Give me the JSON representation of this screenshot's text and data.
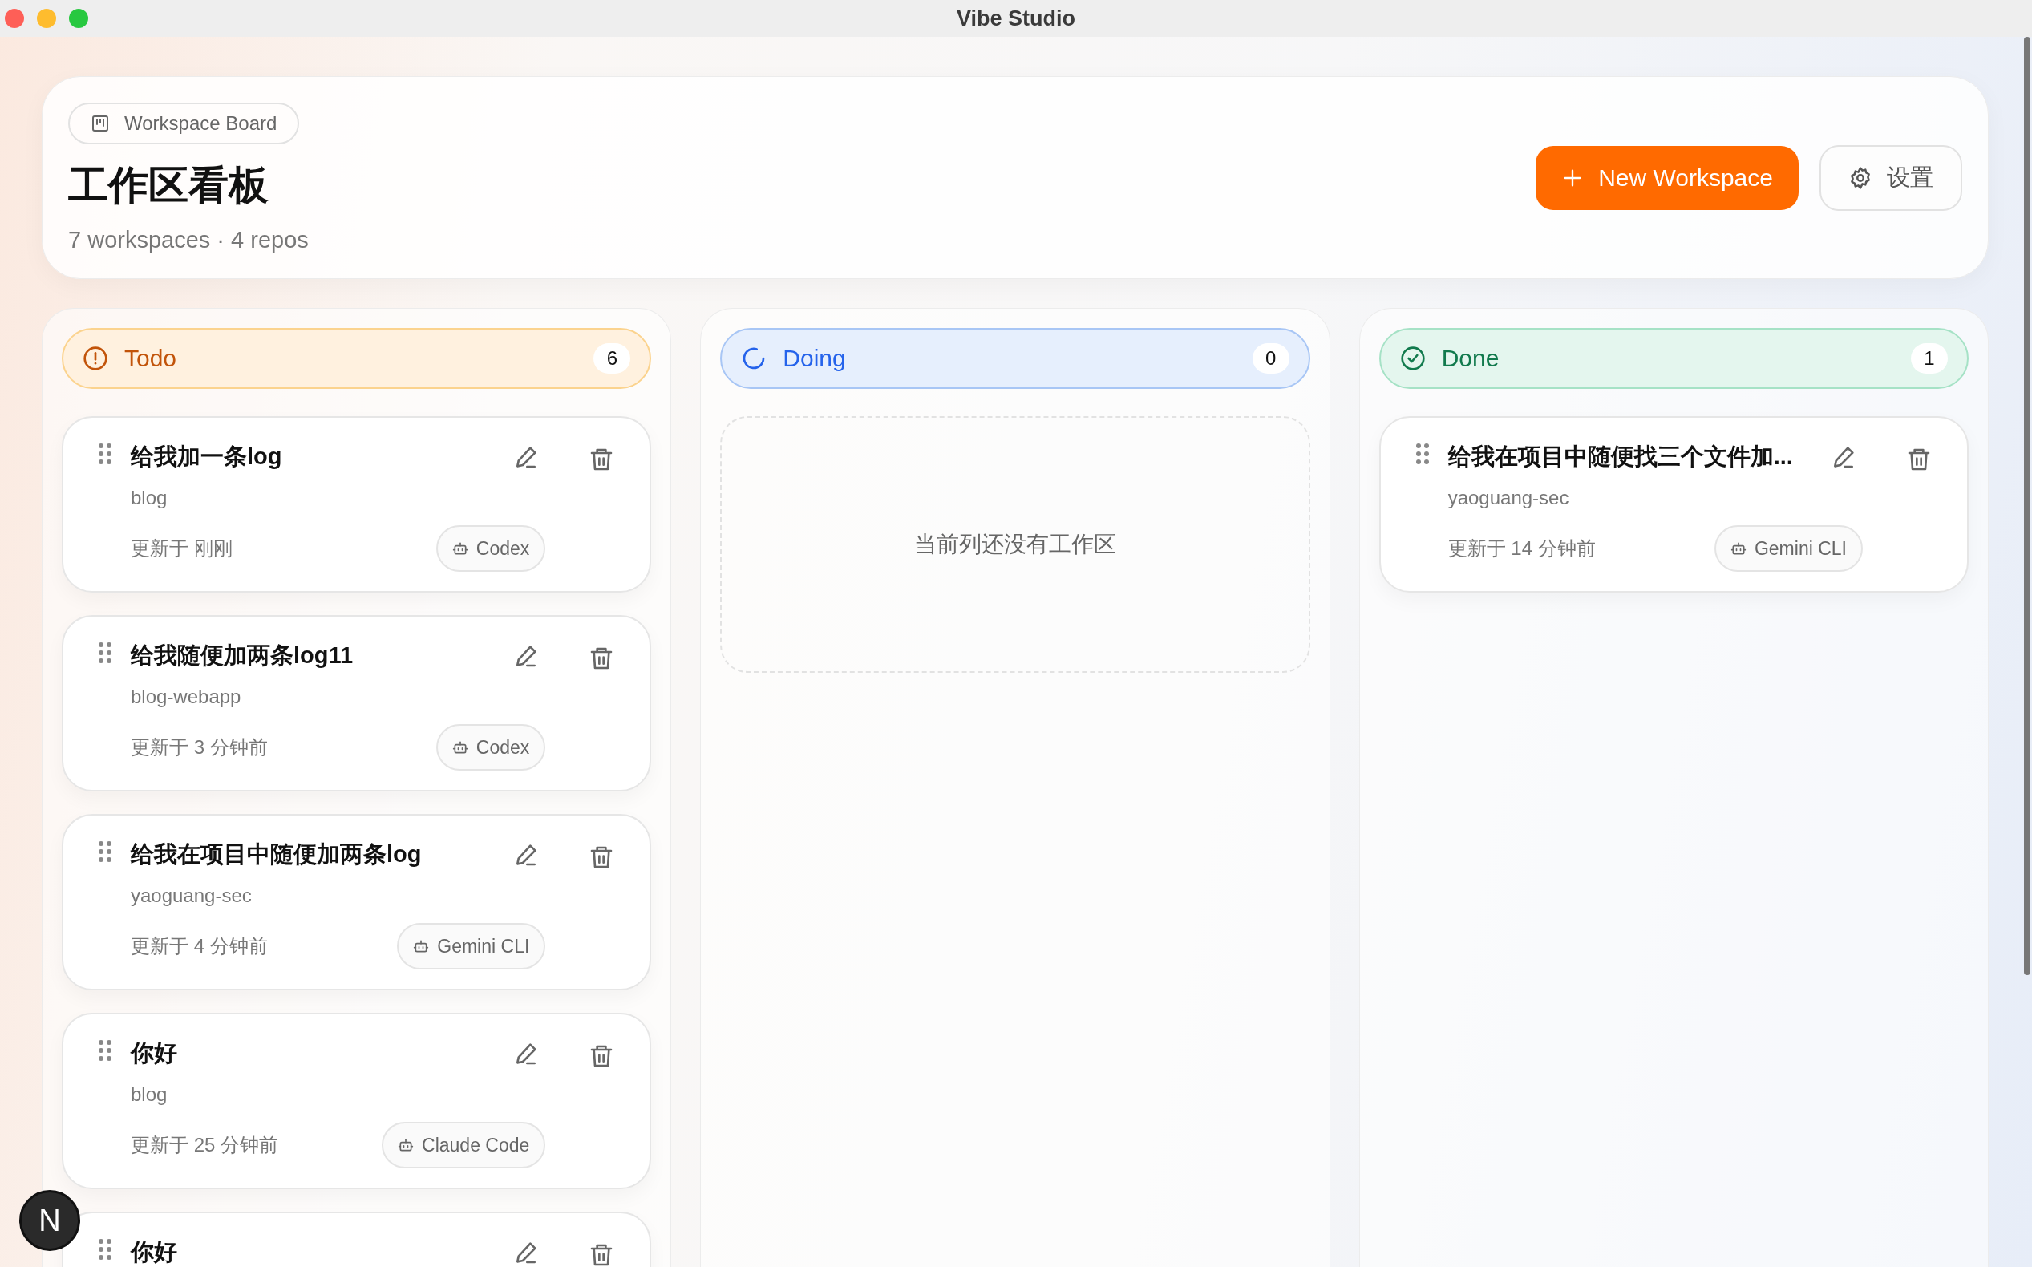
{
  "window": {
    "title": "Vibe Studio"
  },
  "header": {
    "badge": "Workspace Board",
    "title": "工作区看板",
    "subtitle": "7 workspaces · 4 repos",
    "new_button": "New Workspace",
    "settings_button": "设置"
  },
  "columns": [
    {
      "kind": "todo",
      "label": "Todo",
      "count": "6",
      "cards": [
        {
          "title": "给我加一条log",
          "repo": "blog",
          "updated": "更新于 刚刚",
          "agent": "Codex"
        },
        {
          "title": "给我随便加两条log11",
          "repo": "blog-webapp",
          "updated": "更新于 3 分钟前",
          "agent": "Codex"
        },
        {
          "title": "给我在项目中随便加两条log",
          "repo": "yaoguang-sec",
          "updated": "更新于 4 分钟前",
          "agent": "Gemini CLI"
        },
        {
          "title": "你好",
          "repo": "blog",
          "updated": "更新于 25 分钟前",
          "agent": "Claude Code"
        },
        {
          "title": "你好"
        }
      ]
    },
    {
      "kind": "doing",
      "label": "Doing",
      "count": "0",
      "empty_text": "当前列还没有工作区"
    },
    {
      "kind": "done",
      "label": "Done",
      "count": "1",
      "cards": [
        {
          "title": "给我在项目中随便找三个文件加...",
          "repo": "yaoguang-sec",
          "updated": "更新于 14 分钟前",
          "agent": "Gemini CLI"
        }
      ]
    }
  ],
  "dev_badge": "N"
}
